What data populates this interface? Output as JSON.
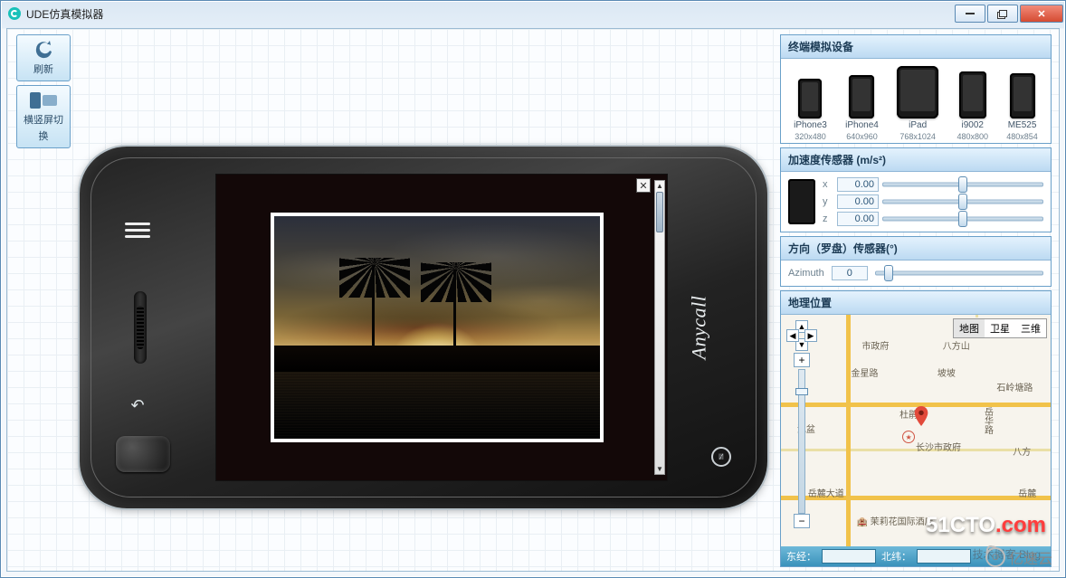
{
  "window": {
    "title": "UDE仿真模拟器"
  },
  "toolbar": {
    "refresh": "刷新",
    "rotate": "横竖屏切换"
  },
  "phone": {
    "brand": "Anycall"
  },
  "panels": {
    "devices": {
      "title": "终端模拟设备",
      "list": [
        {
          "name": "iPhone3",
          "res": "320x480"
        },
        {
          "name": "iPhone4",
          "res": "640x960"
        },
        {
          "name": "iPad",
          "res": "768x1024"
        },
        {
          "name": "i9002",
          "res": "480x800"
        },
        {
          "name": "ME525",
          "res": "480x854"
        }
      ]
    },
    "accel": {
      "title": "加速度传感器 (m/s²)",
      "x_label": "x",
      "y_label": "y",
      "z_label": "z",
      "x": "0.00",
      "y": "0.00",
      "z": "0.00"
    },
    "compass": {
      "title": "方向（罗盘）传感器(°)",
      "label": "Azimuth",
      "value": "0"
    },
    "geo": {
      "title": "地理位置",
      "tabs": {
        "map": "地图",
        "sat": "卫星",
        "three": "三维"
      },
      "labels": {
        "jinxing": "金星路",
        "pobo": "坡坡",
        "dujuan": "杜鹃路",
        "shiling": "石岭塘路",
        "nipen": "泥盆",
        "yuehua": "岳华路",
        "yuelu": "岳麓大道",
        "yuelu2": "岳麓",
        "fuzheng": "市政府",
        "bashan": "八方山",
        "bashan2": "八方",
        "gov": "长沙市政府",
        "hotel": "茉莉花国际酒店"
      },
      "footer": {
        "lng_label": "东经：",
        "lat_label": "北纬：",
        "lng": "",
        "lat": ""
      }
    }
  },
  "watermarks": {
    "cto": "51CTO",
    "com": ".com",
    "ys": "亿速云",
    "blog": "技术博客 Blog"
  }
}
